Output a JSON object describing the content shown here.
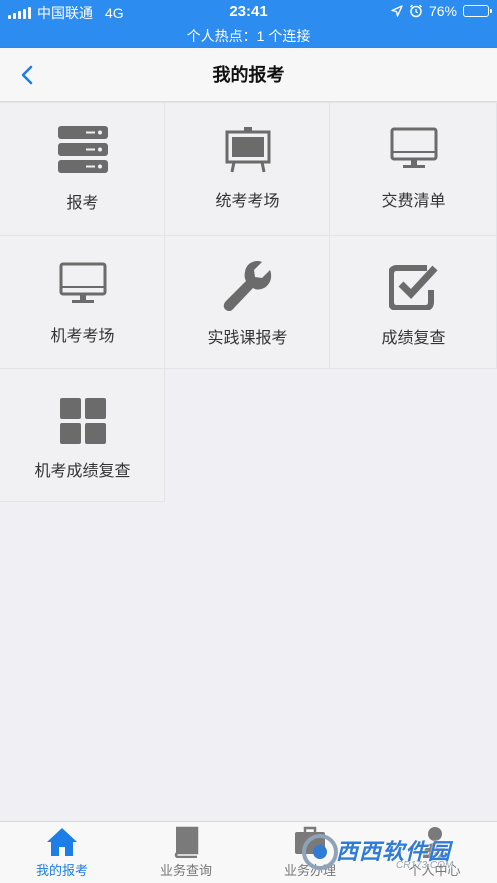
{
  "status_bar": {
    "carrier": "中国联通",
    "network": "4G",
    "time": "23:41",
    "battery": "76%",
    "battery_level": 0.76,
    "hotspot": "个人热点：1 个连接",
    "bg_color": "#2d8cf0"
  },
  "nav": {
    "title": "我的报考",
    "back_icon": "chevron-left-icon"
  },
  "menu": {
    "items": [
      {
        "label": "报考",
        "icon": "server-stack-icon"
      },
      {
        "label": "统考考场",
        "icon": "easel-board-icon"
      },
      {
        "label": "交费清单",
        "icon": "monitor-icon"
      },
      {
        "label": "机考考场",
        "icon": "monitor-icon"
      },
      {
        "label": "实践课报考",
        "icon": "wrench-icon"
      },
      {
        "label": "成绩复查",
        "icon": "checkbox-checked-icon"
      },
      {
        "label": "机考成绩复查",
        "icon": "grid-squares-icon"
      }
    ]
  },
  "tabs": [
    {
      "label": "我的报考",
      "icon": "home-icon",
      "active": true
    },
    {
      "label": "业务查询",
      "icon": "book-icon",
      "active": false
    },
    {
      "label": "业务办理",
      "icon": "briefcase-icon",
      "active": false
    },
    {
      "label": "个人中心",
      "icon": "person-icon",
      "active": false
    }
  ],
  "watermark": {
    "text": "西西软件园",
    "sub": "CR173.COM"
  },
  "colors": {
    "accent": "#1e7ee8",
    "icon_gray": "#6b6b6b",
    "page_bg": "#efeff4"
  }
}
